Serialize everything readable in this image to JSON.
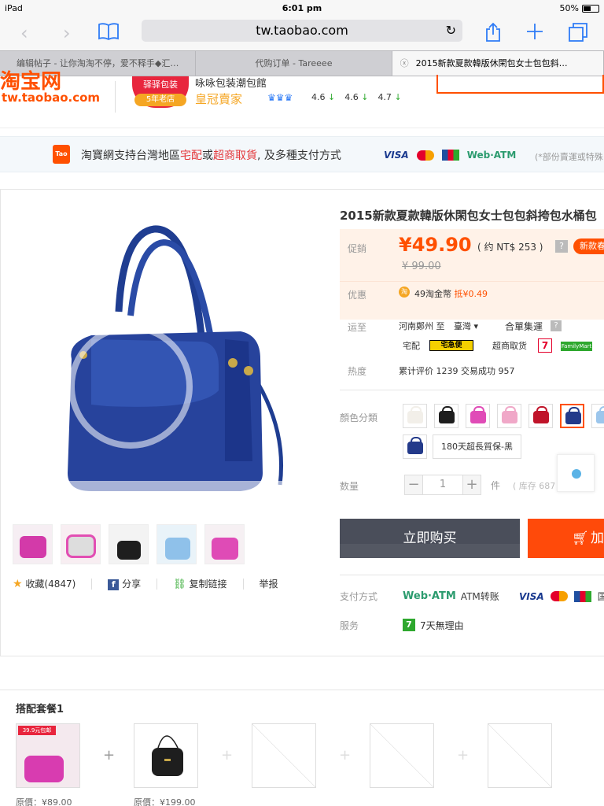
{
  "status_bar": {
    "device": "iPad",
    "time": "6:01 pm",
    "battery": "50%"
  },
  "browser": {
    "url": "tw.taobao.com",
    "tabs": [
      {
        "title": "编辑帖子 - 让你淘淘不停，爱不释手◆汇…"
      },
      {
        "title": "代购订单 - Tareeee"
      },
      {
        "title": "2015新款夏款韓版休閑包女士包包斜…"
      }
    ],
    "icons": {
      "back": "back-icon",
      "forward": "forward-icon",
      "bookmarks": "bookmarks-icon",
      "share": "share-icon",
      "new_tab": "plus-icon",
      "tabs": "tabs-icon",
      "reload": "reload-icon"
    }
  },
  "shop": {
    "logo_text": "淘宝网",
    "logo_url": "tw.taobao.com",
    "badge_text": "驿驿包装",
    "badge_years": "5年老店",
    "name": "咏咏包装潮包館",
    "level": "皇冠賣家",
    "ratings": [
      "4.6",
      "4.6",
      "4.7"
    ]
  },
  "banner": {
    "text_prefix": "淘寶網支持台灣地區",
    "highlight_1": "宅配",
    "text_mid": "或",
    "highlight_2": "超商取貨",
    "text_suffix": ", 及多種支付方式",
    "visa": "VISA",
    "webatm": "Web·ATM",
    "note": "(*部份賣運或特殊"
  },
  "product": {
    "title": "2015新款夏款韓版休閑包女士包包斜挎包水桶包",
    "promo_label": "促銷",
    "price": "¥49.90",
    "price_ntd": "( 约 NT$ 253 )",
    "new_tag": "新款春",
    "original_price": "¥ 99.00",
    "discount_label": "优惠",
    "coin_icon": "淘",
    "coin_text": "49淘金幣",
    "coin_off": "抵¥0.49",
    "ship_label": "运至",
    "ship_from": "河南鄭州 至",
    "ship_to": "臺灣",
    "ship_method": "合單集運",
    "delivery_home": "宅配",
    "black_cat": "宅急便",
    "delivery_store": "超商取货",
    "seven": "7",
    "familymart": "FamilyMart",
    "heat_label": "热度",
    "heat_text": "累计评价 1239 交易成功 957",
    "color_label": "顏色分類",
    "colors": [
      {
        "name": "white",
        "hex": "#f2efe9"
      },
      {
        "name": "black",
        "hex": "#1e1e1e"
      },
      {
        "name": "pink",
        "hex": "#e04cb7"
      },
      {
        "name": "light-pink",
        "hex": "#f0a8c8"
      },
      {
        "name": "red",
        "hex": "#c0142a"
      },
      {
        "name": "navy",
        "hex": "#233a8a",
        "selected": true
      },
      {
        "name": "light-blue",
        "hex": "#9cc6ec"
      }
    ],
    "color_row2": {
      "hex": "#233a8a"
    },
    "warranty": "180天超長質保-黑",
    "qty_label": "数量",
    "qty_value": "1",
    "qty_unit": "件",
    "stock": "( 库存 687",
    "buy_now": "立即购买",
    "add_cart": "加",
    "pay_label": "支付方式",
    "pay_webatm": "Web·ATM",
    "pay_atm": "ATM转账",
    "pay_visa": "VISA",
    "pay_more": "国",
    "service_label": "服务",
    "service_text": "7天無理由",
    "favorite": "收藏(4847)",
    "share": "分享",
    "copy_link": "复制链接",
    "report": "举报"
  },
  "combo": {
    "title": "搭配套餐1",
    "tag_text": "39.9元包邮",
    "price_1": "原價：¥89.00",
    "price_2": "原價：¥199.00"
  }
}
